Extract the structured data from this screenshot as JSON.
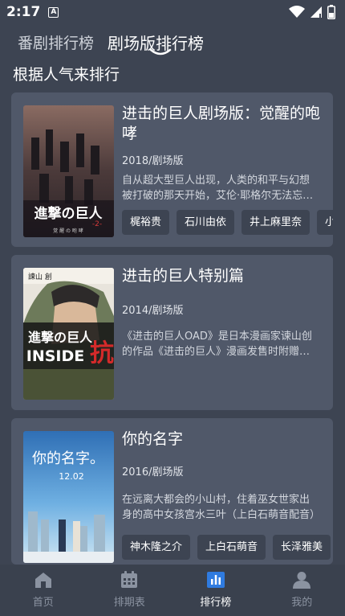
{
  "status": {
    "time": "2:17",
    "notification_badge": "A"
  },
  "tabs": [
    {
      "label": "番剧排行榜",
      "active": false
    },
    {
      "label": "剧场版排行榜",
      "active": true
    }
  ],
  "section_title": "根据人气来排行",
  "items": [
    {
      "title": "进击的巨人剧场版：觉醒的咆哮",
      "meta": "2018/剧场版",
      "desc": "自从超大型巨人出现，人类的和平与幻想被打破的那天开始，艾伦·耶格尔无法忘记那一天",
      "tags": [
        "梶裕贵",
        "石川由依",
        "井上麻里奈",
        "小林由美子"
      ],
      "poster_text": "進撃の巨人"
    },
    {
      "title": "进击的巨人特别篇",
      "meta": "2014/剧场版",
      "desc": "《进击的巨人OAD》是日本漫画家谏山创的作品《进击的巨人》漫画发售时附赠的动画",
      "tags": [],
      "poster_text": "INSIDE"
    },
    {
      "title": "你的名字",
      "meta": "2016/剧场版",
      "desc": "在远离大都会的小山村，住着巫女世家出身的高中女孩宫水三叶（上白石萌音配音）",
      "tags": [
        "神木隆之介",
        "上白石萌音",
        "长泽雅美"
      ],
      "poster_text": "你的名字。12.02"
    }
  ],
  "nav": [
    {
      "label": "首页",
      "icon": "home-icon",
      "active": false
    },
    {
      "label": "排期表",
      "icon": "calendar-icon",
      "active": false
    },
    {
      "label": "排行榜",
      "icon": "ranking-icon",
      "active": true
    },
    {
      "label": "我的",
      "icon": "user-icon",
      "active": false
    }
  ],
  "colors": {
    "background": "#3d4452",
    "card": "#505869",
    "chip": "#3d4452",
    "nav_active": "#ffffff",
    "nav_inactive": "#8b93a1"
  }
}
